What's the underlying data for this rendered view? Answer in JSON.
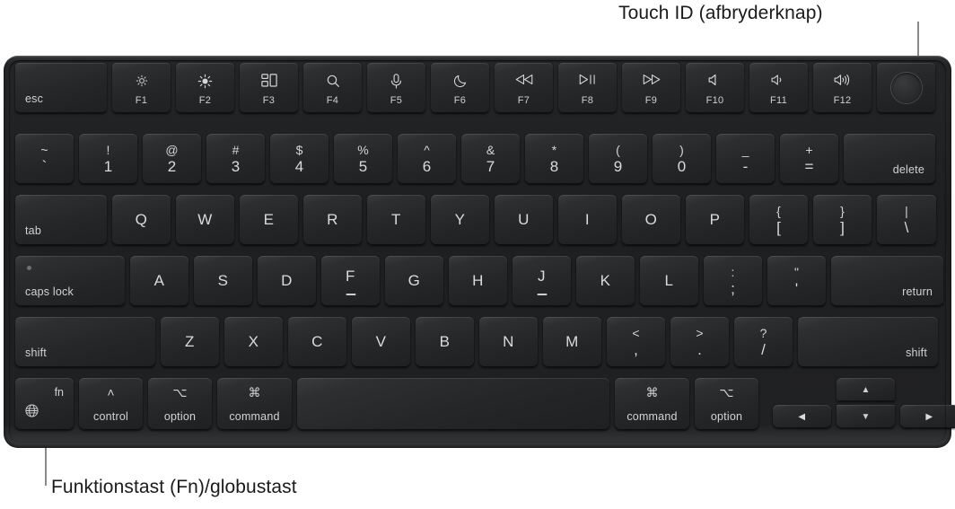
{
  "annotations": {
    "touch_id": "Touch ID (afbryderknap)",
    "fn_key": "Funktionstast (Fn)/globustast"
  },
  "keyboard": {
    "layout": "Apple MacBook Magic Keyboard (US ANSI) with Touch ID",
    "rows": {
      "function_row": [
        {
          "name": "esc",
          "corner_label": "esc"
        },
        {
          "name": "f1",
          "icon": "brightness-down-icon",
          "icon_glyph": "☼",
          "fn_label": "F1"
        },
        {
          "name": "f2",
          "icon": "brightness-up-icon",
          "icon_glyph": "☀",
          "fn_label": "F2"
        },
        {
          "name": "f3",
          "icon": "mission-control-icon",
          "icon_glyph": "",
          "fn_label": "F3"
        },
        {
          "name": "f4",
          "icon": "spotlight-search-icon",
          "icon_glyph": "⌕",
          "fn_label": "F4"
        },
        {
          "name": "f5",
          "icon": "dictation-microphone-icon",
          "icon_glyph": "Ƭ",
          "fn_label": "F5"
        },
        {
          "name": "f6",
          "icon": "do-not-disturb-moon-icon",
          "icon_glyph": "☾",
          "fn_label": "F6"
        },
        {
          "name": "f7",
          "icon": "rewind-icon",
          "icon_glyph": "⏪",
          "fn_label": "F7"
        },
        {
          "name": "f8",
          "icon": "play-pause-icon",
          "icon_glyph": "⏯",
          "fn_label": "F8"
        },
        {
          "name": "f9",
          "icon": "fast-forward-icon",
          "icon_glyph": "⏩",
          "fn_label": "F9"
        },
        {
          "name": "f10",
          "icon": "volume-mute-icon",
          "icon_glyph": "🔈",
          "fn_label": "F10"
        },
        {
          "name": "f11",
          "icon": "volume-down-icon",
          "icon_glyph": "🔉",
          "fn_label": "F11"
        },
        {
          "name": "f12",
          "icon": "volume-up-icon",
          "icon_glyph": "🔊",
          "fn_label": "F12"
        },
        {
          "name": "touch-id",
          "icon": "touch-id-power-button-icon"
        }
      ],
      "number_row": [
        {
          "name": "grave",
          "upper": "~",
          "lower": "`"
        },
        {
          "name": "1",
          "upper": "!",
          "lower": "1"
        },
        {
          "name": "2",
          "upper": "@",
          "lower": "2"
        },
        {
          "name": "3",
          "upper": "#",
          "lower": "3"
        },
        {
          "name": "4",
          "upper": "$",
          "lower": "4"
        },
        {
          "name": "5",
          "upper": "%",
          "lower": "5"
        },
        {
          "name": "6",
          "upper": "^",
          "lower": "6"
        },
        {
          "name": "7",
          "upper": "&",
          "lower": "7"
        },
        {
          "name": "8",
          "upper": "*",
          "lower": "8"
        },
        {
          "name": "9",
          "upper": "(",
          "lower": "9"
        },
        {
          "name": "0",
          "upper": ")",
          "lower": "0"
        },
        {
          "name": "hyphen",
          "upper": "_",
          "lower": "-"
        },
        {
          "name": "equals",
          "upper": "+",
          "lower": "="
        },
        {
          "name": "delete",
          "corner_label": "delete"
        }
      ],
      "top_letter_row": [
        {
          "name": "tab",
          "corner_label": "tab"
        },
        {
          "name": "q",
          "center": "Q"
        },
        {
          "name": "w",
          "center": "W"
        },
        {
          "name": "e",
          "center": "E"
        },
        {
          "name": "r",
          "center": "R"
        },
        {
          "name": "t",
          "center": "T"
        },
        {
          "name": "y",
          "center": "Y"
        },
        {
          "name": "u",
          "center": "U"
        },
        {
          "name": "i",
          "center": "I"
        },
        {
          "name": "o",
          "center": "O"
        },
        {
          "name": "p",
          "center": "P"
        },
        {
          "name": "bracket-left",
          "upper": "{",
          "lower": "["
        },
        {
          "name": "bracket-right",
          "upper": "}",
          "lower": "]"
        },
        {
          "name": "backslash",
          "upper": "|",
          "lower": "\\"
        }
      ],
      "home_row": [
        {
          "name": "caps-lock",
          "corner_label": "caps lock",
          "indicator": true
        },
        {
          "name": "a",
          "center": "A"
        },
        {
          "name": "s",
          "center": "S"
        },
        {
          "name": "d",
          "center": "D"
        },
        {
          "name": "f",
          "center": "F",
          "homing": true
        },
        {
          "name": "g",
          "center": "G"
        },
        {
          "name": "h",
          "center": "H"
        },
        {
          "name": "j",
          "center": "J",
          "homing": true
        },
        {
          "name": "k",
          "center": "K"
        },
        {
          "name": "l",
          "center": "L"
        },
        {
          "name": "semicolon",
          "upper": ":",
          "lower": ";"
        },
        {
          "name": "quote",
          "upper": "\"",
          "lower": "'"
        },
        {
          "name": "return",
          "corner_label": "return"
        }
      ],
      "bottom_letter_row": [
        {
          "name": "shift-left",
          "corner_label": "shift"
        },
        {
          "name": "z",
          "center": "Z"
        },
        {
          "name": "x",
          "center": "X"
        },
        {
          "name": "c",
          "center": "C"
        },
        {
          "name": "v",
          "center": "V"
        },
        {
          "name": "b",
          "center": "B"
        },
        {
          "name": "n",
          "center": "N"
        },
        {
          "name": "m",
          "center": "M"
        },
        {
          "name": "comma",
          "upper": "<",
          "lower": ","
        },
        {
          "name": "period",
          "upper": ">",
          "lower": "."
        },
        {
          "name": "slash",
          "upper": "?",
          "lower": "/"
        },
        {
          "name": "shift-right",
          "corner_label": "shift"
        }
      ],
      "space_row": [
        {
          "name": "fn-globe",
          "corner_top_right": "fn",
          "icon": "globe-icon"
        },
        {
          "name": "control-left",
          "symbol": "˄",
          "word": "control"
        },
        {
          "name": "option-left",
          "symbol": "⌥",
          "word": "option"
        },
        {
          "name": "command-left",
          "symbol": "⌘",
          "word": "command"
        },
        {
          "name": "space",
          "label": ""
        },
        {
          "name": "command-right",
          "symbol": "⌘",
          "word": "command"
        },
        {
          "name": "option-right",
          "symbol": "⌥",
          "word": "option"
        },
        {
          "name": "arrow-left",
          "glyph": "◀"
        },
        {
          "name": "arrow-up",
          "glyph": "▲"
        },
        {
          "name": "arrow-down",
          "glyph": "▼"
        },
        {
          "name": "arrow-right",
          "glyph": "▶"
        }
      ]
    }
  },
  "colors": {
    "page_background": "#ffffff",
    "chassis": "#242527",
    "key_face": "#2a2b2d",
    "legend_text": "#d8d8d8",
    "annotation_text": "#1a1a1a",
    "leader_line": "#8a8a8a"
  }
}
